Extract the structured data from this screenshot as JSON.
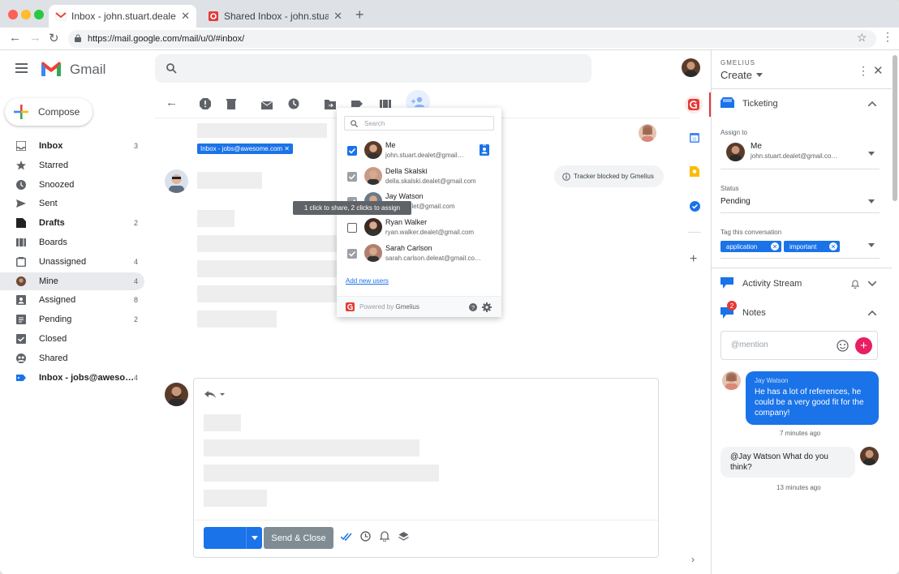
{
  "browser": {
    "tabs": [
      {
        "title": "Inbox - john.stuart.dealet@g…",
        "active": true
      },
      {
        "title": "Shared Inbox - john.stuart.d…",
        "active": false
      }
    ],
    "url": "https://mail.google.com/mail/u/0/#inbox/"
  },
  "gmail": {
    "logo_text": "Gmail",
    "compose_label": "Compose",
    "nav": [
      {
        "label": "Inbox",
        "count": "3",
        "bold": true,
        "icon": "inbox-icon"
      },
      {
        "label": "Starred",
        "count": "",
        "bold": false,
        "icon": "star-icon"
      },
      {
        "label": "Snoozed",
        "count": "",
        "bold": false,
        "icon": "clock-icon"
      },
      {
        "label": "Sent",
        "count": "",
        "bold": false,
        "icon": "send-icon"
      },
      {
        "label": "Drafts",
        "count": "2",
        "bold": true,
        "icon": "draft-icon"
      },
      {
        "label": "Boards",
        "count": "",
        "bold": false,
        "icon": "boards-icon"
      },
      {
        "label": "Unassigned",
        "count": "4",
        "bold": false,
        "icon": "unassigned-icon"
      },
      {
        "label": "Mine",
        "count": "4",
        "bold": false,
        "icon": "avatar-icon"
      },
      {
        "label": "Assigned",
        "count": "8",
        "bold": false,
        "icon": "assigned-icon"
      },
      {
        "label": "Pending",
        "count": "2",
        "bold": false,
        "icon": "pending-icon"
      },
      {
        "label": "Closed",
        "count": "",
        "bold": false,
        "icon": "closed-icon"
      },
      {
        "label": "Shared",
        "count": "",
        "bold": false,
        "icon": "shared-icon"
      },
      {
        "label": "Inbox - jobs@awesо…",
        "count": "4",
        "bold": true,
        "icon": "label-icon"
      }
    ],
    "label_chip": "Inbox - jobs@awesome.com",
    "tracker_text": "Tracker blocked by Gmelius",
    "send_close_label": "Send & Close"
  },
  "dropdown": {
    "search_placeholder": "Search",
    "users": [
      {
        "name": "Me",
        "email": "john.stuart.dealet@gmail…",
        "state": "checked"
      },
      {
        "name": "Della Skalski",
        "email": "della.skalski.dealet@gmail.com",
        "state": "gray"
      },
      {
        "name": "Jay Watson",
        "email": "…on.dealet@gmail.com",
        "state": "gray"
      },
      {
        "name": "Ryan Walker",
        "email": "ryan.walker.dealet@gmail.com",
        "state": "off"
      },
      {
        "name": "Sarah Carlson",
        "email": "sarah.carlson.deleat@gmail.co…",
        "state": "gray"
      }
    ],
    "add_new_users": "Add new users",
    "powered_by": "Powered by",
    "powered_brand": "Gmelius",
    "tooltip": "1 click to share, 2 clicks to assign"
  },
  "panel": {
    "brand": "GMELIUS",
    "create_label": "Create",
    "ticketing": "Ticketing",
    "assign_to_label": "Assign to",
    "assignee_name": "Me",
    "assignee_email": "john.stuart.dealet@gmail.co…",
    "status_label": "Status",
    "status_value": "Pending",
    "tag_label": "Tag this conversation",
    "tags": [
      "application",
      "important"
    ],
    "activity_stream": "Activity Stream",
    "notes": "Notes",
    "notes_badge": "2",
    "mention_placeholder": "@mention",
    "messages": [
      {
        "author": "Jay Watson",
        "text": "He has a lot of references, he could be a very good fit for the company!",
        "time": "7 minutes ago"
      },
      {
        "author": "",
        "text": "@Jay Watson What do you think?",
        "time": "13 minutes ago"
      }
    ]
  },
  "colors": {
    "accent": "#1a73e8",
    "gmelius_red": "#e53935",
    "pink": "#e91e63"
  }
}
